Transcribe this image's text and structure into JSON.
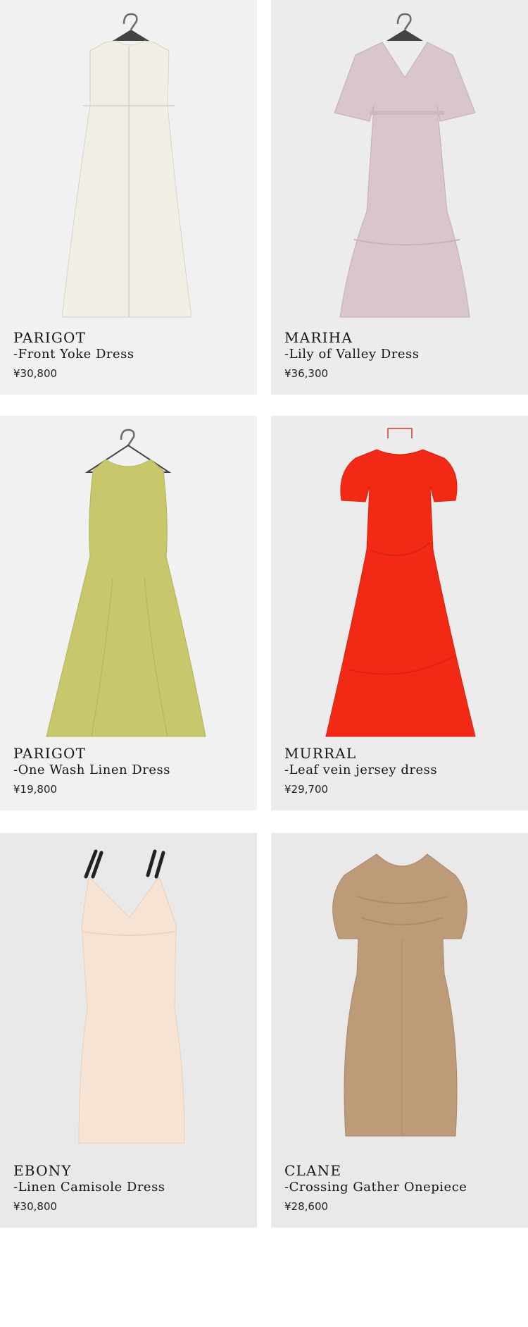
{
  "products": [
    {
      "brand": "PARIGOT",
      "name": "-Front Yoke Dress",
      "price": "¥30,800",
      "color": "#f1eee5",
      "icon": "dress-sleeveless-shirt-icon"
    },
    {
      "brand": "MARIHA",
      "name": "-Lily of Valley Dress",
      "price": "¥36,300",
      "color": "#d9c5cc",
      "icon": "dress-flutter-sleeve-icon"
    },
    {
      "brand": "PARIGOT",
      "name": "-One Wash Linen Dress",
      "price": "¥19,800",
      "color": "#c8c76c",
      "icon": "dress-sleeveless-aline-icon"
    },
    {
      "brand": "MURRAL",
      "name": "-Leaf vein jersey dress",
      "price": "¥29,700",
      "color": "#f22a15",
      "icon": "dress-puff-sleeve-icon"
    },
    {
      "brand": "EBONY",
      "name": "-Linen Camisole Dress",
      "price": "¥30,800",
      "color": "#f6e3d3",
      "icon": "dress-camisole-icon"
    },
    {
      "brand": "CLANE",
      "name": "-Crossing Gather Onepiece",
      "price": "¥28,600",
      "color": "#bd9a78",
      "icon": "dress-gathered-sleeve-icon"
    }
  ]
}
